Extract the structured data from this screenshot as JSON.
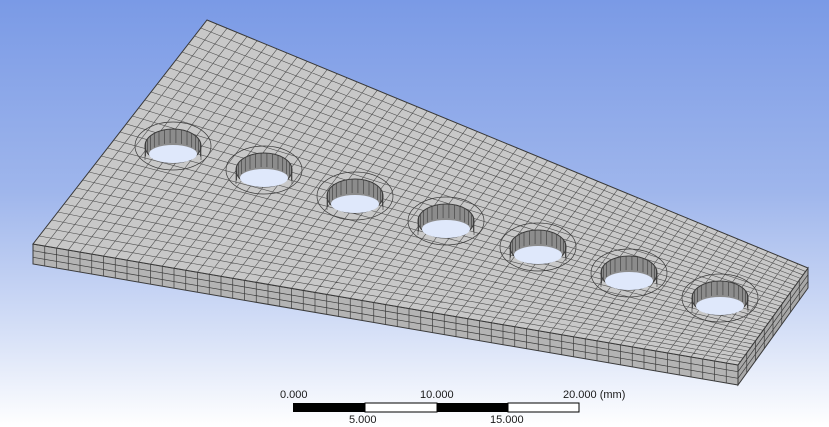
{
  "viewport": {
    "background_top": "#7a9ae6",
    "background_bottom": "#ffffff"
  },
  "model": {
    "description_icon": "mesh-plate-icon",
    "face_color": "#c8c8c8",
    "side_color": "#b4b4b4",
    "edge_color": "#3a3a3a",
    "hole_count": 7
  },
  "scale": {
    "top_labels": [
      "0.000",
      "10.000",
      "20.000 (mm)"
    ],
    "bottom_labels": [
      "5.000",
      "15.000"
    ]
  }
}
